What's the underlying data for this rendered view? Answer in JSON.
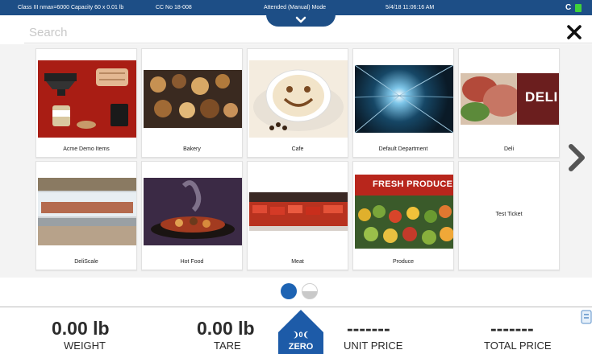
{
  "status_bar": {
    "scale_info": "Class III nmax=6000 Capacity 60 x 0.01 lb",
    "cc_no": "CC No 18-008",
    "mode": "Attended (Manual) Mode",
    "datetime": "5/4/18 11:06:16 AM",
    "connection": "C",
    "colors": {
      "bar": "#1d4e86",
      "battery": "#3fd13b"
    }
  },
  "search": {
    "placeholder": "Search",
    "close_icon": "close-icon"
  },
  "departments": [
    {
      "label": "Acme Demo Items",
      "icon": "anvil-demo-image"
    },
    {
      "label": "Bakery",
      "icon": "bakery-image"
    },
    {
      "label": "Cafe",
      "icon": "latte-art-image"
    },
    {
      "label": "Default Department",
      "icon": "light-tunnel-image"
    },
    {
      "label": "Deli",
      "icon": "deli-meat-image",
      "image_text": "DELI"
    },
    {
      "label": "DeliScale",
      "icon": "deli-case-image"
    },
    {
      "label": "Hot Food",
      "icon": "hot-food-image"
    },
    {
      "label": "Meat",
      "icon": "meat-case-image"
    },
    {
      "label": "Produce",
      "icon": "produce-image",
      "image_text": "FRESH PRODUCE"
    },
    {
      "label": "Test Ticket",
      "icon": ""
    }
  ],
  "paging": {
    "pages": 2,
    "current": 1,
    "next_icon": "chevron-right-icon"
  },
  "readouts": {
    "weight": {
      "value": "0.00 lb",
      "label": "WEIGHT"
    },
    "tare": {
      "value": "0.00 lb",
      "label": "TARE"
    },
    "zero": {
      "symbol": "❩0❨",
      "label": "ZERO"
    },
    "unit_price": {
      "value": "-------",
      "label": "UNIT PRICE"
    },
    "total_price": {
      "value": "-------",
      "label": "TOTAL PRICE"
    }
  }
}
